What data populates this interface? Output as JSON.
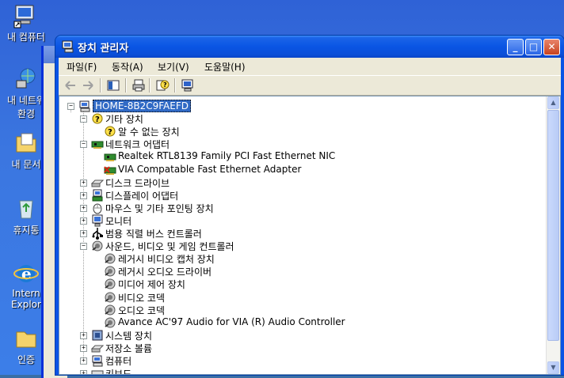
{
  "desktop": {
    "icons": [
      {
        "label": "내 컴퓨터",
        "icon": "my-computer-icon"
      },
      {
        "label": "내 네트워",
        "label2": "환경",
        "icon": "network-places-icon"
      },
      {
        "label": "내 문서",
        "icon": "my-documents-icon"
      },
      {
        "label": "휴지통",
        "icon": "recycle-bin-icon"
      },
      {
        "label": "Intern",
        "label2": "Explor",
        "icon": "internet-explorer-icon"
      },
      {
        "label": "인증",
        "icon": "folder-icon"
      }
    ]
  },
  "window": {
    "title": "장치 관리자",
    "menu": [
      "파일(F)",
      "동작(A)",
      "보기(V)",
      "도움말(H)"
    ]
  },
  "tree": [
    {
      "label": "HOME-8B2C9FAEFD",
      "depth": 0,
      "exp": "−",
      "icon": "computer-icon",
      "selected": true
    },
    {
      "label": "기타 장치",
      "depth": 1,
      "exp": "−",
      "icon": "unknown-device-icon"
    },
    {
      "label": "알 수 없는 장치",
      "depth": 2,
      "exp": "",
      "icon": "unknown-device-icon"
    },
    {
      "label": "네트워크 어댑터",
      "depth": 1,
      "exp": "−",
      "icon": "network-adapter-icon"
    },
    {
      "label": "Realtek RTL8139 Family PCI Fast Ethernet NIC",
      "depth": 2,
      "exp": "",
      "icon": "network-adapter-icon"
    },
    {
      "label": "VIA Compatable Fast Ethernet Adapter",
      "depth": 2,
      "exp": "",
      "icon": "network-adapter-disabled-icon"
    },
    {
      "label": "디스크 드라이브",
      "depth": 1,
      "exp": "+",
      "icon": "disk-drive-icon"
    },
    {
      "label": "디스플레이 어댑터",
      "depth": 1,
      "exp": "+",
      "icon": "display-adapter-icon"
    },
    {
      "label": "마우스 및 기타 포인팅 장치",
      "depth": 1,
      "exp": "+",
      "icon": "mouse-icon"
    },
    {
      "label": "모니터",
      "depth": 1,
      "exp": "+",
      "icon": "monitor-icon"
    },
    {
      "label": "범용 직렬 버스 컨트롤러",
      "depth": 1,
      "exp": "+",
      "icon": "usb-icon"
    },
    {
      "label": "사운드, 비디오 및 게임 컨트롤러",
      "depth": 1,
      "exp": "−",
      "icon": "sound-icon"
    },
    {
      "label": "레거시 비디오 캡처 장치",
      "depth": 2,
      "exp": "",
      "icon": "sound-icon"
    },
    {
      "label": "레거시 오디오 드라이버",
      "depth": 2,
      "exp": "",
      "icon": "sound-icon"
    },
    {
      "label": "미디어 제어 장치",
      "depth": 2,
      "exp": "",
      "icon": "sound-icon"
    },
    {
      "label": "비디오 코덱",
      "depth": 2,
      "exp": "",
      "icon": "sound-icon"
    },
    {
      "label": "오디오 코덱",
      "depth": 2,
      "exp": "",
      "icon": "sound-icon"
    },
    {
      "label": "Avance AC'97 Audio for VIA (R) Audio Controller",
      "depth": 2,
      "exp": "",
      "icon": "sound-icon"
    },
    {
      "label": "시스템 장치",
      "depth": 1,
      "exp": "+",
      "icon": "system-device-icon"
    },
    {
      "label": "저장소 볼륨",
      "depth": 1,
      "exp": "+",
      "icon": "storage-volume-icon"
    },
    {
      "label": "컴퓨터",
      "depth": 1,
      "exp": "+",
      "icon": "computer-icon"
    },
    {
      "label": "키보드",
      "depth": 1,
      "exp": "+",
      "icon": "keyboard-icon"
    }
  ]
}
